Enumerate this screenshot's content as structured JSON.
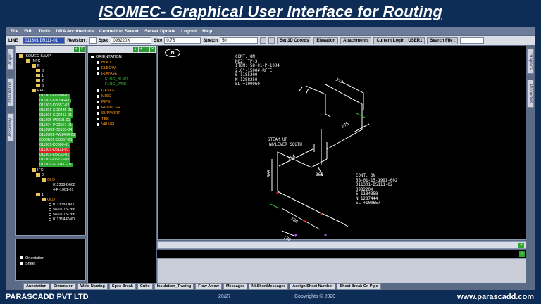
{
  "slide": {
    "title": "ISOMEC- Graphical User Interface for Routing",
    "company": "PARASCADD PVT LTD",
    "page": "20/27",
    "copyright": "Copyrights © 2020",
    "website": "www.parascadd.com"
  },
  "menu": [
    "File",
    "Edit",
    "Tools",
    "DRA Architecture",
    "Connect to Server",
    "Server Update",
    "Logout",
    "Help"
  ],
  "toolbar": {
    "line_label": "LINE :",
    "line_value": "011301 D5111-01",
    "revision_label": "Revision :",
    "spec_label": "Spec",
    "spec_value": "098220X",
    "size_label": "Size",
    "size_value": "0.75",
    "stretch_label": "Stretch",
    "stretch_value": "50",
    "set3d": "Set 3D Coords",
    "elevation": "Elevation",
    "attachments": "Attachments",
    "current_login": "Current Login : USER1",
    "search_file": "Search File :"
  },
  "left_tabs": [
    "Project",
    "Orientation",
    "Assembly"
  ],
  "right_tabs": [
    "Graphics",
    "Properties"
  ],
  "tree": {
    "root": "ISOMEC SAMP",
    "infc": "INFC",
    "r": "R",
    "n0": "0",
    "n1": "1",
    "n2": "2",
    "n3": "3",
    "epc": "EPC",
    "epc_items": [
      "011301-D5200-01",
      "011301-FW1464-0",
      "011301-D0657-02",
      "011301-SO0435-01",
      "011301-SO0413-01",
      "011205-IA0691-01",
      "011204-PC0567-01",
      "0113U01-D5103-04",
      "0113U01-FW1464-01",
      "0500U01-D5057-01",
      "011301-D0609-01"
    ],
    "selected": "011301-D5111-01",
    "epc_items2": [
      "011301-D5233-01",
      "011301-D5233-03",
      "011301-SO0417-01"
    ],
    "ifc": "IFC",
    "ifc0": "0",
    "old1": "OLD",
    "old1_items": [
      "011308-D600",
      "4-P-1001-01"
    ],
    "ifc1": "1",
    "old2": "OLD",
    "old2_items": [
      "011308-D600",
      "58-01-15-266",
      "58-01-15-266",
      "011314-FWD"
    ]
  },
  "components": {
    "root": "ORIENTATION",
    "items": [
      "BOLT",
      "ELBOW",
      "FLANGE"
    ],
    "flange_sub": [
      "FLNG_BLND",
      "FLNG_WNK"
    ],
    "items2": [
      "GASKET",
      "MISC",
      "PIPE",
      "REDUCER",
      "SUPPORT",
      "TEE",
      "VALVFL"
    ]
  },
  "orientation_panel": [
    "Orientation",
    "Sheet"
  ],
  "canvas": {
    "north": "N",
    "anno_top": "CONT. ON\nNOZ: TP-3\nITEM: 58-01-P-1004\n2.0\"-1500#-RFFE\nE 1185300\nN 1288250\nEL +100960",
    "anno_steam": "STEAM UP\nHW/LEVER SOUTH",
    "anno_bottom": "CONT. ON\n58-01-15-1991-002\n011301-D5111-02\n098220X\nE 1184358\nN 1287444\nEL +100657",
    "dims": [
      "377",
      "275",
      "284",
      "368",
      "505",
      "280",
      "180"
    ]
  },
  "bottom_tabs": [
    "Annotation",
    "Dimension",
    "Weld Naming",
    "Spec Break",
    "Cube",
    "Insulation_Tracing",
    "Flow Arrow",
    "Messages",
    "NbShortMessages",
    "Assign Sheet Number",
    "Sheet Break On Pipe"
  ],
  "colors": {
    "background": "#0d2d57",
    "selected": "#e02020",
    "ok": "#2ea82e",
    "pipe": "#ffffff"
  }
}
